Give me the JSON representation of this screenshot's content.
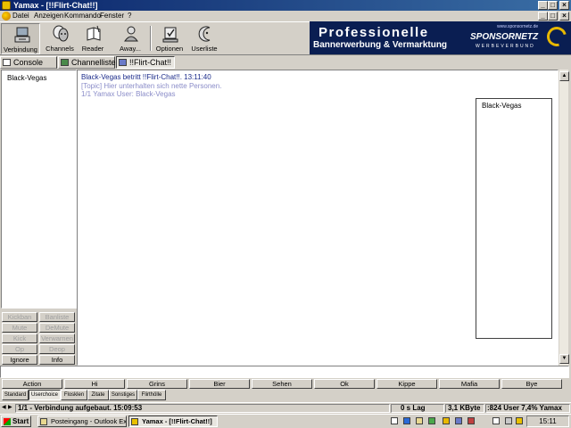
{
  "window": {
    "title": "Yamax - [!!Flirt-Chat!!]"
  },
  "menu": [
    "Datei",
    "Anzeigen",
    "Kommando",
    "Fenster",
    "?"
  ],
  "toolbar": {
    "items": [
      {
        "label": "Verbindung",
        "icon": "connect-icon"
      },
      {
        "label": "Channels",
        "icon": "channels-icon"
      },
      {
        "label": "Reader",
        "icon": "reader-icon"
      },
      {
        "label": "Away...",
        "icon": "away-icon"
      },
      {
        "label": "Optionen",
        "icon": "options-icon"
      },
      {
        "label": "Userliste",
        "icon": "userlist-icon"
      }
    ]
  },
  "banner": {
    "line1": "Professionelle",
    "line2": "Bannerwerbung & Vermarktung",
    "url": "www.sponsornetz.de",
    "brand": "SPONSORNETZ",
    "tagline": "WERBEVERBUND"
  },
  "tabs": [
    "Console",
    "Channelliste",
    "!!Flirt-Chat!!"
  ],
  "left_panel": {
    "nick": "Black-Vegas"
  },
  "op_buttons": {
    "kickban": "Kickban",
    "banliste": "Banliste",
    "mute": "Mute",
    "demute": "DeMute",
    "kick": "Kick",
    "verwarnen": "Verwarnen",
    "op": "Op",
    "deop": "Deop",
    "ignore": "Ignore",
    "info": "Info"
  },
  "chat": {
    "lines": [
      "Black-Vegas betritt !!Flirt-Chat!!. 13:11:40",
      "[Topic] Hier unterhalten sich nette Personen.",
      "1/1 Yamax User: Black-Vegas"
    ]
  },
  "userlist": {
    "nick": "Black-Vegas"
  },
  "quick_buttons": [
    "Action",
    "Hi",
    "Grins",
    "Bier",
    "Sehen",
    "Ok",
    "Kippe",
    "Mafia",
    "Bye"
  ],
  "category_tabs": [
    "Standard",
    "Userchoice",
    "Flosklen",
    "Zitate",
    "Sonstiges",
    "Flirthölle"
  ],
  "status": {
    "connection": "1/1 - Verbindung aufgebaut. 15:09:53",
    "lag": "0 s Lag",
    "traffic": "3,1 KByte",
    "users": ":824 User 7,4% Yamax"
  },
  "taskbar": {
    "start": "Start",
    "tasks": [
      "Posteingang - Outlook Ex...",
      "Yamax - [!!Flirt-Chat!!]"
    ],
    "clock": "15:11"
  },
  "colors": {
    "titlebar": "#0a246a",
    "banner": "#0a1e52",
    "join_text": "#1b2b8a",
    "topic_text": "#8a8cc8"
  }
}
